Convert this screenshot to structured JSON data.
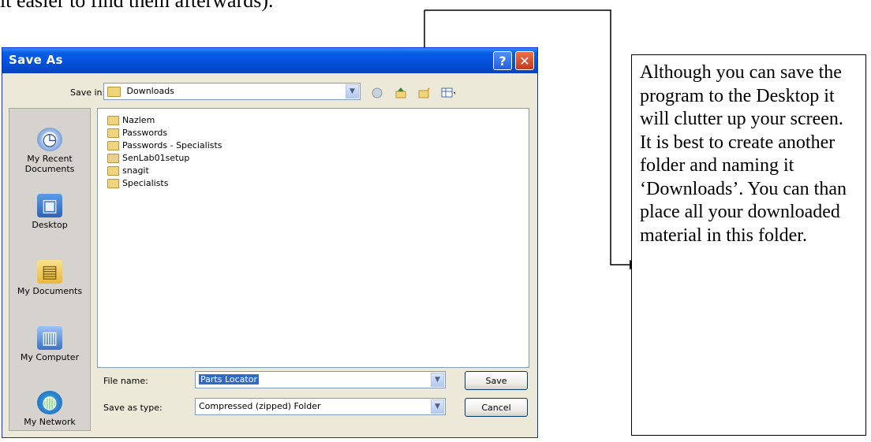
{
  "intro_text": "it easier to find them afterwards).",
  "dialog": {
    "title": "Save As",
    "help_glyph": "?",
    "close_glyph": "✕",
    "save_in_label": "Save in:",
    "save_in_value": "Downloads",
    "places": [
      {
        "label": "My Recent\nDocuments",
        "icon": "recent-documents-icon"
      },
      {
        "label": "Desktop",
        "icon": "desktop-icon"
      },
      {
        "label": "My Documents",
        "icon": "my-documents-icon"
      },
      {
        "label": "My Computer",
        "icon": "my-computer-icon"
      },
      {
        "label": "My Network",
        "icon": "my-network-icon"
      }
    ],
    "files": [
      "Nazlem",
      "Passwords",
      "Passwords - Specialists",
      "SenLab01setup",
      "snagit",
      "Specialists"
    ],
    "file_name_label": "File name:",
    "file_name_value": "Parts Locator",
    "save_type_label": "Save as type:",
    "save_type_value": "Compressed (zipped) Folder",
    "save_button": "Save",
    "cancel_button": "Cancel"
  },
  "note": {
    "text": "Although you can save the program to the Desktop it will clutter up your screen. It is best to create another folder and naming it ‘Downloads’. You can than place all your downloaded material in this folder."
  },
  "colors": {
    "title_bar": "#0553df",
    "dialog_bg": "#ece9d8",
    "selection": "#316ac5"
  }
}
